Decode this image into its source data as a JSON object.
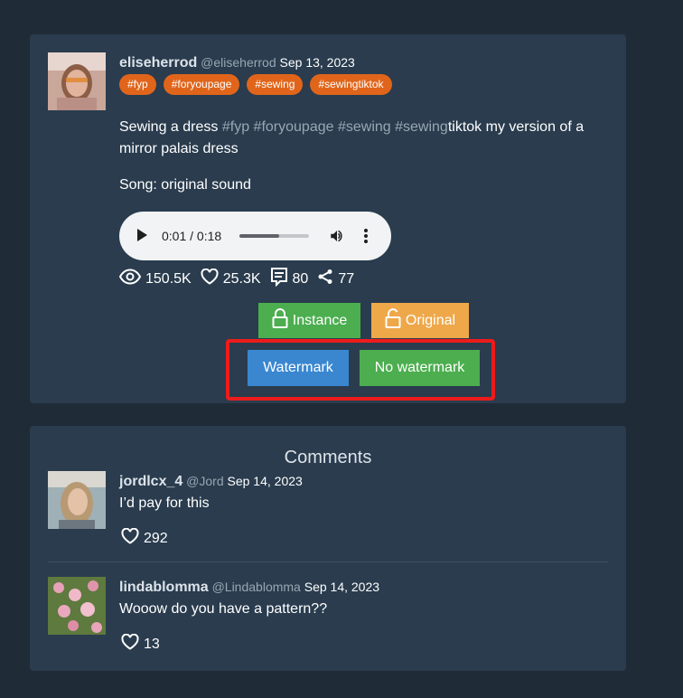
{
  "post": {
    "author_name": "eliseherrod",
    "author_handle": "@eliseherrod",
    "date": "Sep 13, 2023",
    "tags": [
      "#fyp",
      "#foryoupage",
      "#sewing",
      "#sewingtiktok"
    ],
    "description": {
      "text1": "Sewing a dress ",
      "hash1": "#fyp",
      "space1": " ",
      "hash2": "#foryoupage",
      "space2": " ",
      "hash3": "#sewing",
      "space3": " ",
      "hash4": "#sewing",
      "text2": "tiktok my version of a mirror palais dress"
    },
    "song": "Song: original sound",
    "player": {
      "time": "0:01 / 0:18",
      "progress": 0.57
    },
    "stats": {
      "views": "150.5K",
      "likes": "25.3K",
      "comments": "80",
      "shares": "77"
    },
    "buttons": {
      "instance": "Instance",
      "original": "Original",
      "watermark": "Watermark",
      "no_watermark": "No watermark"
    }
  },
  "comments": {
    "title": "Comments",
    "items": [
      {
        "name": "jordlcx_4",
        "handle": "@Jord",
        "date": "Sep 14, 2023",
        "text": "I’d pay for this",
        "likes": "292"
      },
      {
        "name": "lindablomma",
        "handle": "@Lindablomma",
        "date": "Sep 14, 2023",
        "text": "Wooow do you have a pattern??",
        "likes": "13"
      }
    ]
  },
  "colors": {
    "background": "#1f2b37",
    "card": "#2a3c4e",
    "tag": "#e0651a",
    "green_button": "#4cae4f",
    "orange_button": "#eea84a",
    "blue_button": "#3a87d0",
    "highlight": "#ec1c1c"
  },
  "icons": {
    "views": "eye-icon",
    "likes": "heart-icon",
    "comments": "comment-icon",
    "shares": "share-icon",
    "instance": "lock-icon",
    "original": "unlock-icon"
  }
}
